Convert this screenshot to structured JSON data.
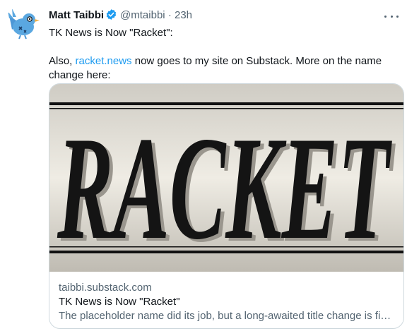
{
  "tweet": {
    "display_name": "Matt Taibbi",
    "handle": "@mtaibbi",
    "separator": "·",
    "time": "23h",
    "line1": "TK News is Now \"Racket\":",
    "line2_prefix": "Also, ",
    "line2_link": "racket.news",
    "line2_suffix": " now goes to my site on Substack. More on the name change here:"
  },
  "card": {
    "image_word": "RACKET",
    "domain": "taibbi.substack.com",
    "title": "TK News is Now \"Racket\"",
    "description": "The placeholder name did its job, but a long-awaited title change is finally here"
  },
  "colors": {
    "accent": "#1d9bf0",
    "text": "#0f1419",
    "muted": "#536471",
    "border": "#cfd9de",
    "avatar_bird": "#5aa7e0"
  },
  "icons": {
    "avatar": "blue-bird-with-glasses",
    "verified": "verified-badge-icon",
    "more": "more-dots-icon"
  }
}
